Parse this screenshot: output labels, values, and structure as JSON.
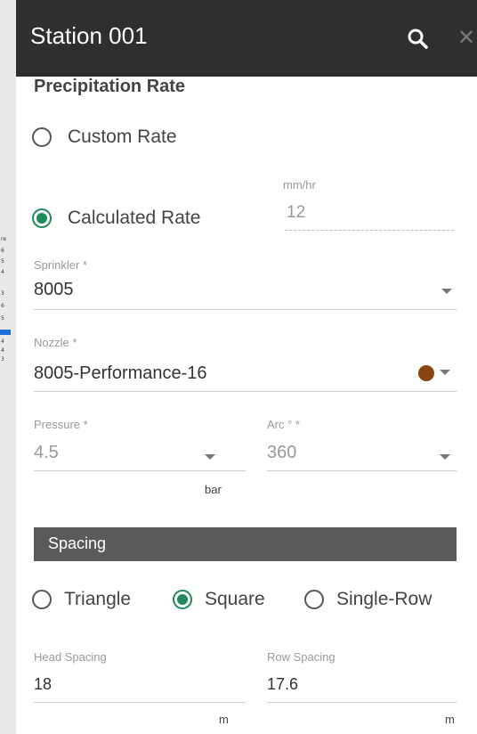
{
  "background_app": {
    "strip_lines_top": [
      "re",
      "6",
      "5",
      "4",
      "3",
      "6",
      "5"
    ],
    "strip_lines_bottom": [
      "4",
      "4",
      "3"
    ]
  },
  "header": {
    "title": "Station 001",
    "search_icon": "search-icon",
    "close_icon": "close-icon"
  },
  "precipitation": {
    "title": "Precipitation Rate",
    "custom_label": "Custom Rate",
    "calculated_label": "Calculated Rate",
    "selected": "calculated",
    "rate_unit": "mm/hr",
    "rate_value": "12"
  },
  "sprinkler": {
    "label": "Sprinkler *",
    "value": "8005"
  },
  "nozzle": {
    "label": "Nozzle *",
    "value": "8005-Performance-16",
    "color": "#8b4513"
  },
  "pressure": {
    "label": "Pressure *",
    "value": "4.5",
    "unit": "bar"
  },
  "arc": {
    "label": "Arc ° *",
    "value": "360"
  },
  "spacing": {
    "title": "Spacing",
    "options": [
      "Triangle",
      "Square",
      "Single-Row"
    ],
    "selected": "Square",
    "head_label": "Head Spacing",
    "head_value": "18",
    "head_unit": "m",
    "row_label": "Row Spacing",
    "row_value": "17.6",
    "row_unit": "m"
  },
  "colors": {
    "accent": "#1f8a5b",
    "header_bg": "#2f2f2f",
    "section_bar": "#5a5a5a"
  }
}
